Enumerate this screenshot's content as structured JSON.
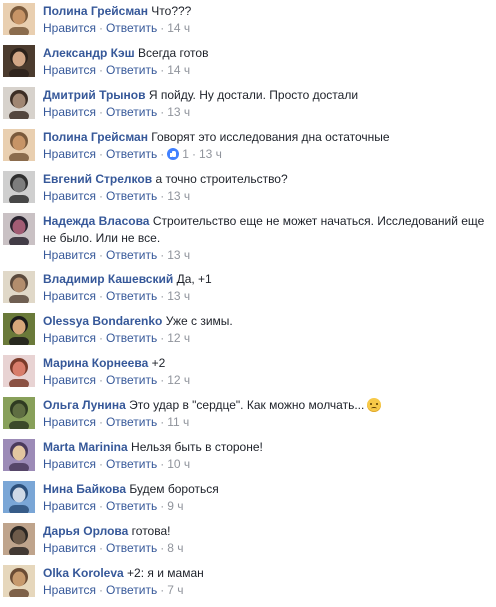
{
  "actions": {
    "like": "Нравится",
    "reply": "Ответить",
    "sep": "·"
  },
  "colors": {
    "author": "#365899",
    "meta": "#90949c",
    "text": "#1d2129"
  },
  "comments": [
    {
      "author": "Полина Грейсман",
      "text": "Что???",
      "time": "14 ч",
      "avatar_colors": [
        "#e9cfb0",
        "#c79466",
        "#7a5a3c"
      ]
    },
    {
      "author": "Александр Кэш",
      "text": "Всегда готов",
      "time": "14 ч",
      "avatar_colors": [
        "#4b3b2e",
        "#d1a686",
        "#2c221b"
      ]
    },
    {
      "author": "Дмитрий Трынов",
      "text": "Я пойду. Ну достали. Просто достали",
      "time": "13 ч",
      "avatar_colors": [
        "#d7d2cc",
        "#a08672",
        "#3c2e25"
      ]
    },
    {
      "author": "Полина Грейсман",
      "text": "Говорят это исследования дна остаточные",
      "time": "13 ч",
      "likes": "1",
      "avatar_colors": [
        "#e9cfb0",
        "#c79466",
        "#7a5a3c"
      ]
    },
    {
      "author": "Евгений Стрелков",
      "text": "а точно строительство?",
      "time": "13 ч",
      "avatar_colors": [
        "#cfcfcf",
        "#7d7d7d",
        "#2f2f2f"
      ]
    },
    {
      "author": "Надежда Власова",
      "text": "Строительство еще не может начаться. Исследований еще не было. Или не все.",
      "time": "13 ч",
      "avatar_colors": [
        "#c9c1c4",
        "#a25c74",
        "#2a2430"
      ]
    },
    {
      "author": "Владимир Кашевский",
      "text": "Да, +1",
      "time": "13 ч",
      "avatar_colors": [
        "#e0d8c8",
        "#b28d6d",
        "#5b4a3d"
      ]
    },
    {
      "author": "Olessya Bondarenko",
      "text": "Уже с зимы.",
      "time": "12 ч",
      "avatar_colors": [
        "#6a7a3a",
        "#d7a77b",
        "#1b1b1b"
      ]
    },
    {
      "author": "Марина Корнеева",
      "text": "+2",
      "time": "12 ч",
      "avatar_colors": [
        "#e8d3d3",
        "#d87d6b",
        "#7a3b2a"
      ]
    },
    {
      "author": "Ольга Лунина",
      "text": "Это удар в \"сердце\". Как можно молчать...",
      "time": "11 ч",
      "emoji": true,
      "avatar_colors": [
        "#88a05a",
        "#5f6e42",
        "#2f3b22"
      ]
    },
    {
      "author": "Marta Marinina",
      "text": "Нельзя быть в стороне!",
      "time": "10 ч",
      "avatar_colors": [
        "#9c8bb7",
        "#e3c6a0",
        "#4a3a5c"
      ]
    },
    {
      "author": "Нина Байкова",
      "text": "Будем бороться",
      "time": "9 ч",
      "avatar_colors": [
        "#7aa6d6",
        "#cfd9e6",
        "#2c4f7a"
      ]
    },
    {
      "author": "Дарья Орлова",
      "text": "готова!",
      "time": "8 ч",
      "avatar_colors": [
        "#bfa48c",
        "#6e5b4a",
        "#2b2723"
      ]
    },
    {
      "author": "Olka Koroleva",
      "text": "+2: я и маман",
      "time": "7 ч",
      "avatar_colors": [
        "#e6d7bc",
        "#c79a6e",
        "#6b4c35"
      ]
    }
  ]
}
